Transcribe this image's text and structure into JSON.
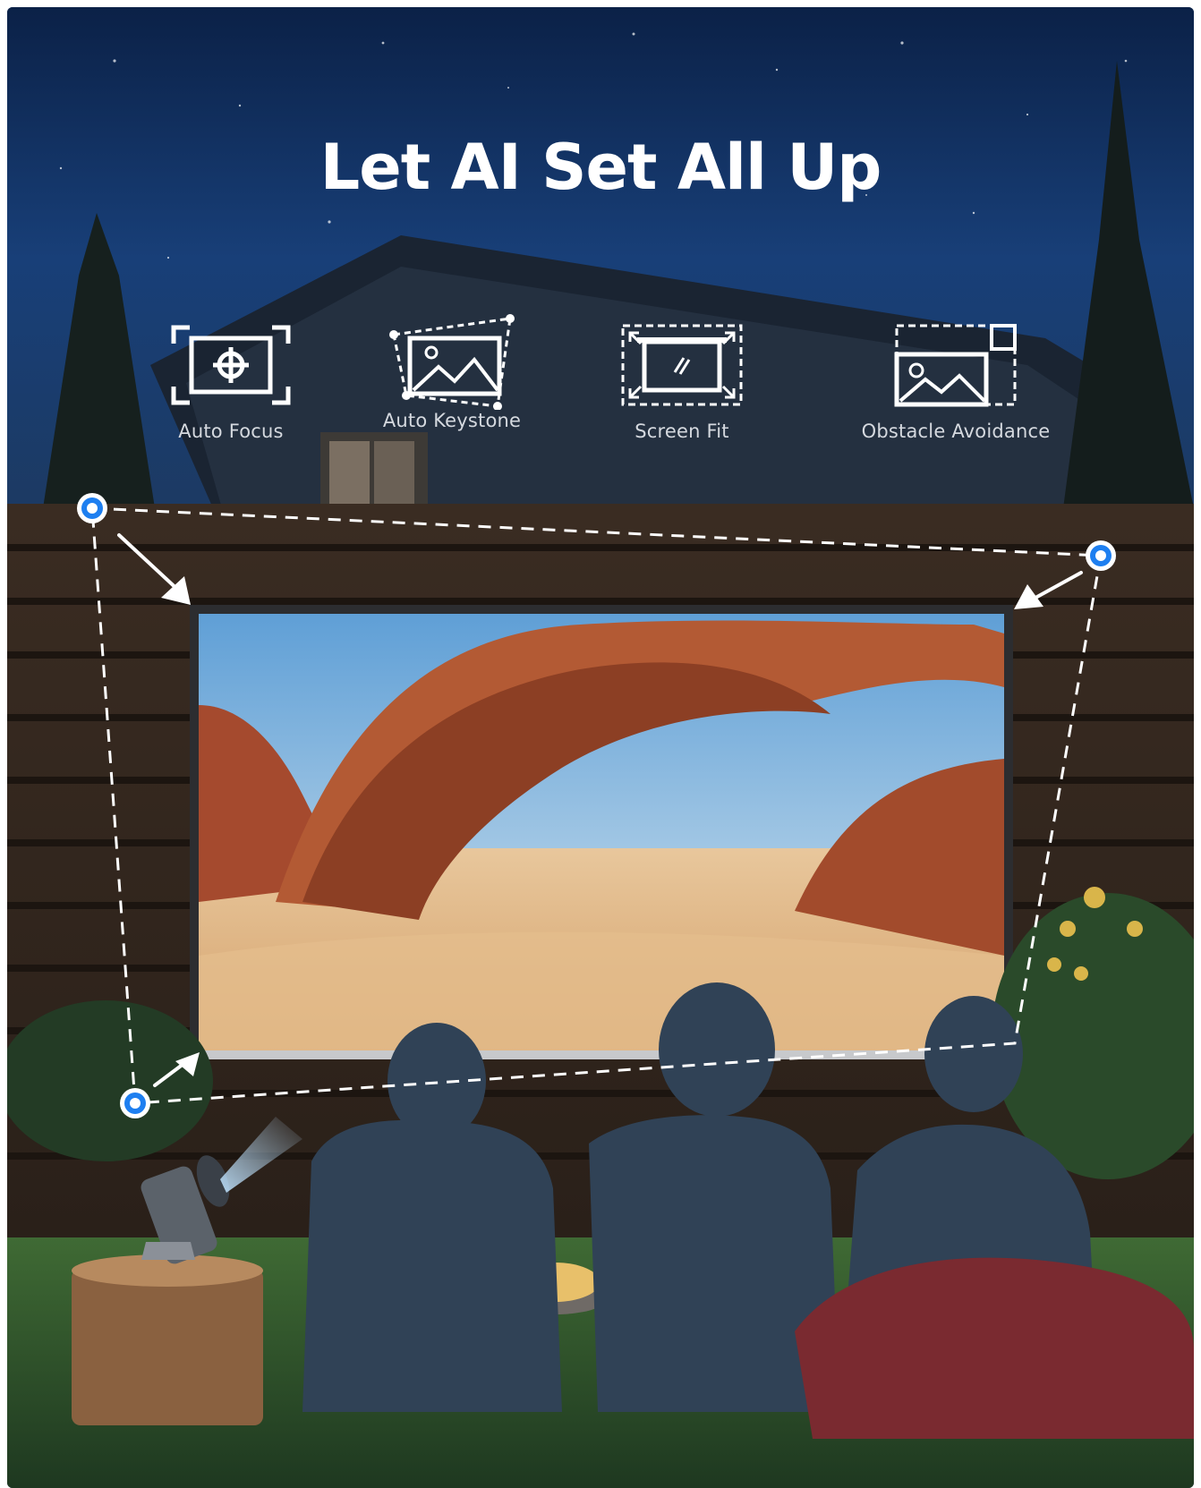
{
  "headline": "Let AI Set All Up",
  "features": [
    {
      "label": "Auto Focus",
      "icon": "auto-focus-icon"
    },
    {
      "label": "Auto Keystone",
      "icon": "auto-keystone-icon"
    },
    {
      "label": "Screen Fit",
      "icon": "screen-fit-icon"
    },
    {
      "label": "Obstacle Avoidance",
      "icon": "obstacle-avoidance-icon"
    }
  ],
  "colors": {
    "night_sky": "#0d2a57",
    "marker_blue": "#1e7ff0",
    "icon_white": "#ffffff",
    "label_gray": "#d5d9df"
  }
}
